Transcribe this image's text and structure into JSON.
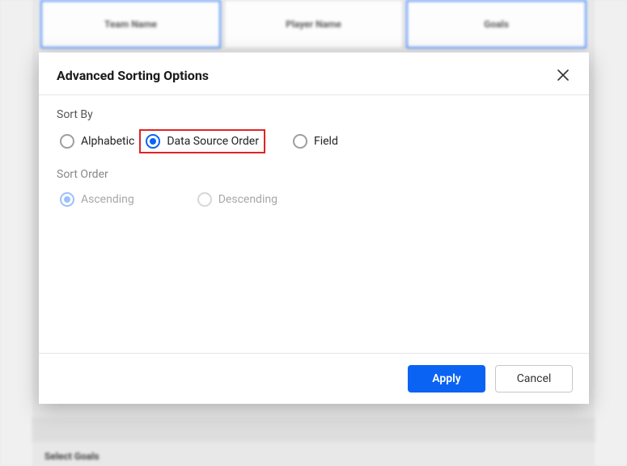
{
  "bg": {
    "col1": "Team Name",
    "col2": "Player Name",
    "col3": "Goals",
    "bottom_label": "Select Goals"
  },
  "modal": {
    "title": "Advanced Sorting Options",
    "sort_by_label": "Sort By",
    "options": {
      "alphabetic": "Alphabetic",
      "data_source_order": "Data Source Order",
      "field": "Field"
    },
    "sort_order_label": "Sort Order",
    "order_options": {
      "ascending": "Ascending",
      "descending": "Descending"
    },
    "sort_by_selected": "data_source_order",
    "sort_order_selected": "ascending",
    "sort_order_disabled": true,
    "footer": {
      "apply": "Apply",
      "cancel": "Cancel"
    }
  }
}
